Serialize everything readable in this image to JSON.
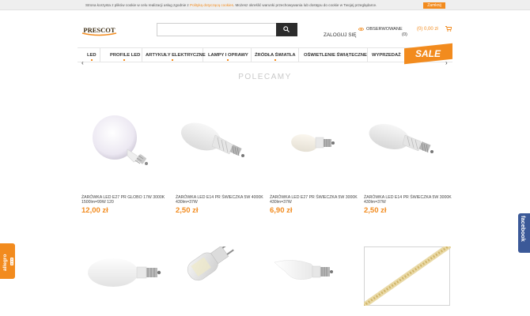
{
  "cookie": {
    "text_before": "Strona korzysta z plików cookie w celu realizacji usług zgodnie z ",
    "link": "Polityką dotyczącą cookies",
    "text_after": ". Możesz określić warunki przechowywania lub dostępu do cookie w Twojej przeglądarce.",
    "close_label": "Zamknij"
  },
  "header": {
    "logo_text": "PRESCOT",
    "search_placeholder": "",
    "login_label": "ZALOGUJ SIĘ",
    "watch_label": "OBSERWOWANE",
    "watch_count": "(0)",
    "cart_label": "(0) 0,00 zł"
  },
  "nav": {
    "items": [
      "LED",
      "PROFILE LED",
      "ARTYKUŁY ELEKTRYCZNE",
      "LAMPY I OPRAWY",
      "ŹRÓDŁA ŚWIATŁA",
      "OŚWIETLENIE ŚWIĄTECZNE",
      "WYPRZEDAŻ"
    ],
    "sale_badge": "SALE",
    "prev_arrow": "‹",
    "next_arrow": "›"
  },
  "section": {
    "title": "POLECAMY"
  },
  "products": [
    {
      "name": "ŻARÓWKA LED E27 PR GLOBO 17W 3000K 1500lm=99W 120",
      "price": "12,00 zł"
    },
    {
      "name": "ŻARÓWKA LED E14 PR ŚWIECZKA 5W 4000K 430lm=37W",
      "price": "2,50 zł"
    },
    {
      "name": "ŻARÓWKA LED E27 PR ŚWIECZKA 5W 3000K 430lm=37W",
      "price": "6,90 zł"
    },
    {
      "name": "ŻARÓWKA LED E14 PR ŚWIECZKA 5W 3000K 430lm=37W",
      "price": "2,50 zł"
    },
    {
      "name": "",
      "price": ""
    },
    {
      "name": "",
      "price": ""
    },
    {
      "name": "",
      "price": ""
    },
    {
      "name": "",
      "price": ""
    }
  ],
  "side": {
    "allegro_label": "allegro",
    "facebook_label": "facebook"
  },
  "colors": {
    "accent": "#f28b1e",
    "facebook": "#3b5998",
    "dark": "#2c2c2c"
  }
}
